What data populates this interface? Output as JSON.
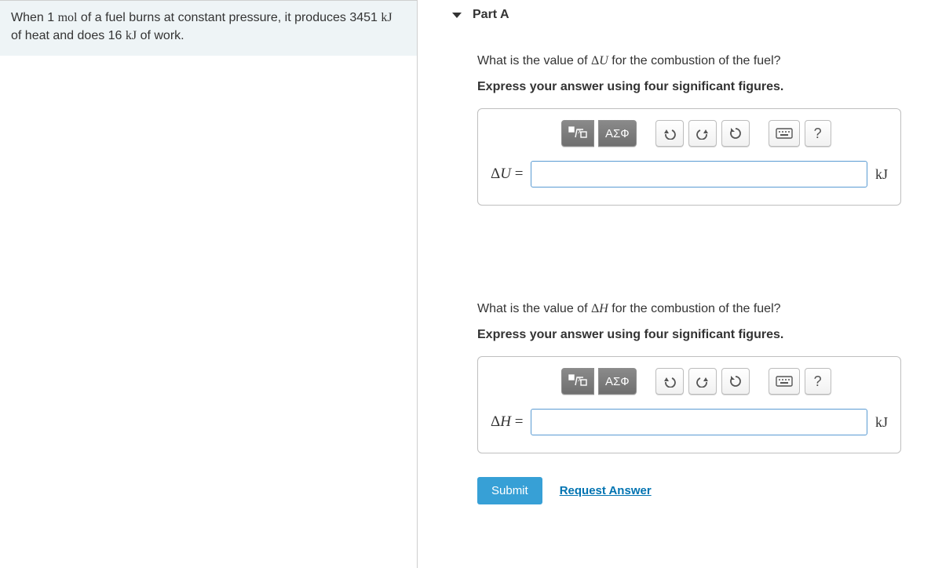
{
  "problem": {
    "text_prefix": "When 1 ",
    "mol": "mol",
    "text_mid1": " of a fuel burns at constant pressure, it produces 3451 ",
    "kj1": "kJ",
    "text_mid2": " of heat and does 16 ",
    "kj2": "kJ",
    "text_suffix": " of work."
  },
  "part": {
    "title": "Part A"
  },
  "q1": {
    "prompt_pre": "What is the value of ",
    "prompt_var": "ΔU",
    "prompt_post": " for the combustion of the fuel?",
    "instruction": "Express your answer using four significant figures.",
    "var_label": "ΔU =",
    "unit": "kJ",
    "value": ""
  },
  "q2": {
    "prompt_pre": "What is the value of ",
    "prompt_var": "ΔH",
    "prompt_post": " for the combustion of the fuel?",
    "instruction": "Express your answer using four significant figures.",
    "var_label": "ΔH =",
    "unit": "kJ",
    "value": ""
  },
  "toolbar": {
    "greek_label": "ΑΣФ",
    "help": "?"
  },
  "actions": {
    "submit": "Submit",
    "request": "Request Answer"
  }
}
